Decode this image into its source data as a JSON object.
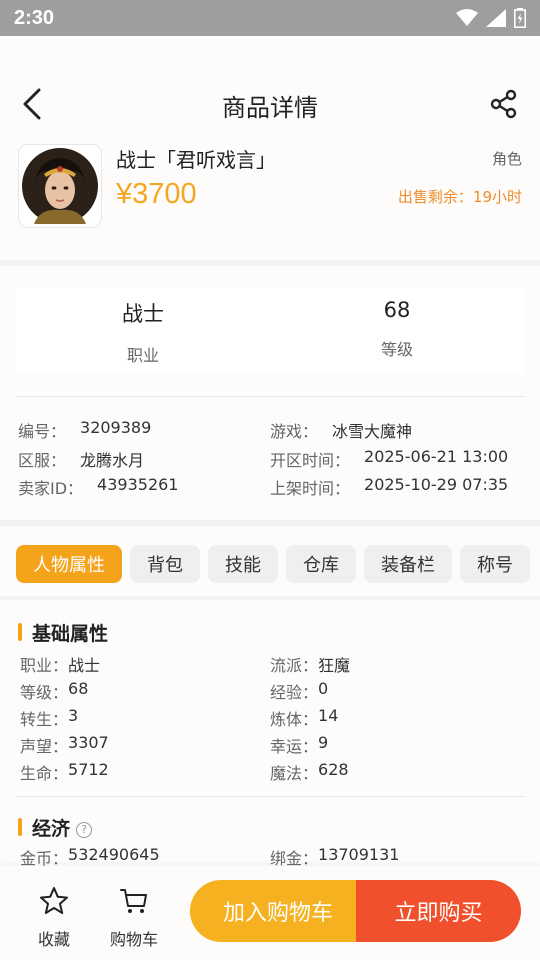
{
  "status": {
    "time": "2:30"
  },
  "nav": {
    "title": "商品详情"
  },
  "product": {
    "name": "战士「君听戏言」",
    "price": "¥3700",
    "type": "角色",
    "remaining_label": "出售剩余：",
    "remaining_value": "19小时"
  },
  "stats": [
    {
      "value": "战士",
      "label": "职业"
    },
    {
      "value": "68",
      "label": "等级"
    }
  ],
  "info": {
    "rows": [
      [
        {
          "k": "编号：",
          "v": "3209389"
        },
        {
          "k": "游戏：",
          "v": "冰雪大魔神"
        }
      ],
      [
        {
          "k": "区服：",
          "v": "龙腾水月"
        },
        {
          "k": "开区时间：",
          "v": "2025-06-21 13:00"
        }
      ],
      [
        {
          "k": "卖家ID：",
          "v": "43935261"
        },
        {
          "k": "上架时间：",
          "v": "2025-10-29 07:35"
        }
      ]
    ]
  },
  "tabs": [
    "人物属性",
    "背包",
    "技能",
    "仓库",
    "装备栏",
    "称号"
  ],
  "basic": {
    "title": "基础属性",
    "rows": [
      [
        {
          "k": "职业：",
          "v": "战士"
        },
        {
          "k": "流派：",
          "v": "狂魔"
        }
      ],
      [
        {
          "k": "等级：",
          "v": "68"
        },
        {
          "k": "经验：",
          "v": "0"
        }
      ],
      [
        {
          "k": "转生：",
          "v": "3"
        },
        {
          "k": "炼体：",
          "v": "14"
        }
      ],
      [
        {
          "k": "声望：",
          "v": "3307"
        },
        {
          "k": "幸运：",
          "v": "9"
        }
      ],
      [
        {
          "k": "生命：",
          "v": "5712"
        },
        {
          "k": "魔法：",
          "v": "628"
        }
      ]
    ]
  },
  "economy": {
    "title": "经济",
    "help_icon": "?",
    "rows": [
      [
        {
          "k": "金币：",
          "v": "532490645"
        },
        {
          "k": "绑金：",
          "v": "13709131"
        }
      ]
    ]
  },
  "bottom": {
    "favorite": "收藏",
    "cart": "购物车",
    "add_to_cart": "加入购物车",
    "buy_now": "立即购买"
  },
  "colors": {
    "accent": "#f5a31a",
    "price": "#f4a623",
    "buy": "#f0502b"
  },
  "icons": [
    "wifi-icon",
    "signal-icon",
    "battery-icon",
    "back-icon",
    "share-icon",
    "star-icon",
    "cart-icon",
    "help-icon"
  ]
}
